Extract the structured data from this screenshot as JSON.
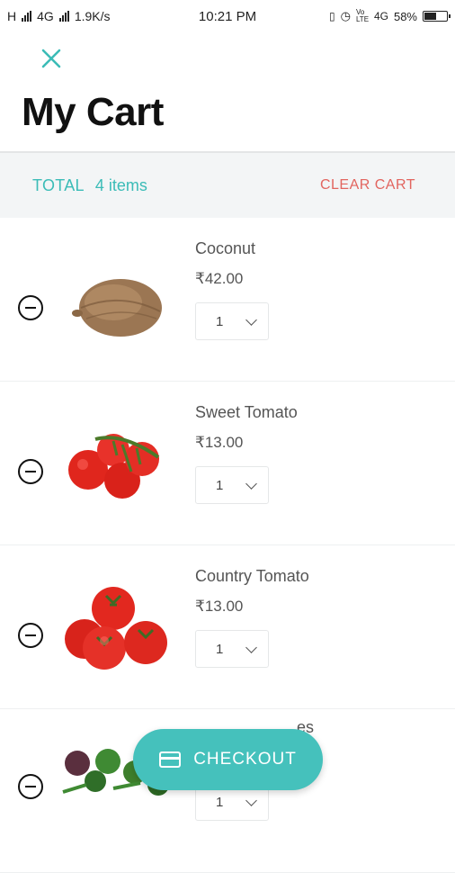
{
  "status_bar": {
    "network_left": "H",
    "network_right": "4G",
    "speed": "1.9K/s",
    "time": "10:21 PM",
    "volte": "Vo LTE",
    "network_4g": "4G",
    "battery_percent": "58%",
    "battery_level": 0.58
  },
  "header": {
    "close_icon": "close-icon",
    "title": "My Cart"
  },
  "summary": {
    "total_label": "TOTAL",
    "items_count": "4 items",
    "clear_cart_label": "CLEAR CART"
  },
  "cart": {
    "items": [
      {
        "name": "Coconut",
        "price": "₹42.00",
        "quantity": "1",
        "image": "coconut"
      },
      {
        "name": "Sweet Tomato",
        "price": "₹13.00",
        "quantity": "1",
        "image": "tomato-vine"
      },
      {
        "name": "Country Tomato",
        "price": "₹13.00",
        "quantity": "1",
        "image": "tomato-bunch"
      },
      {
        "name": "es",
        "price": "",
        "quantity": "1",
        "image": "greens"
      }
    ]
  },
  "checkout": {
    "label": "CHECKOUT",
    "icon": "credit-card-icon"
  },
  "colors": {
    "accent": "#45c1bc",
    "danger": "#e2655f"
  }
}
